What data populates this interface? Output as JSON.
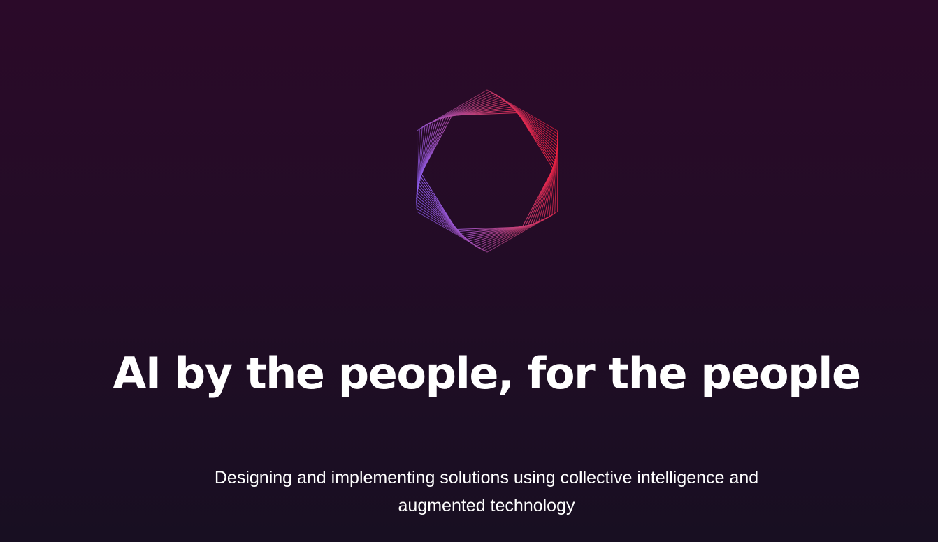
{
  "hero": {
    "logo_icon": "hexagon-spiral-logo-icon",
    "headline": "AI by the people, for the people",
    "subtitle": "Designing and implementing solutions using collective intelligence and augmented technology"
  },
  "colors": {
    "background_top": "#2b0a29",
    "background_bottom": "#180f22",
    "logo_gradient_start": "#8a5cf0",
    "logo_gradient_end": "#ef1f3f",
    "text": "#ffffff"
  }
}
